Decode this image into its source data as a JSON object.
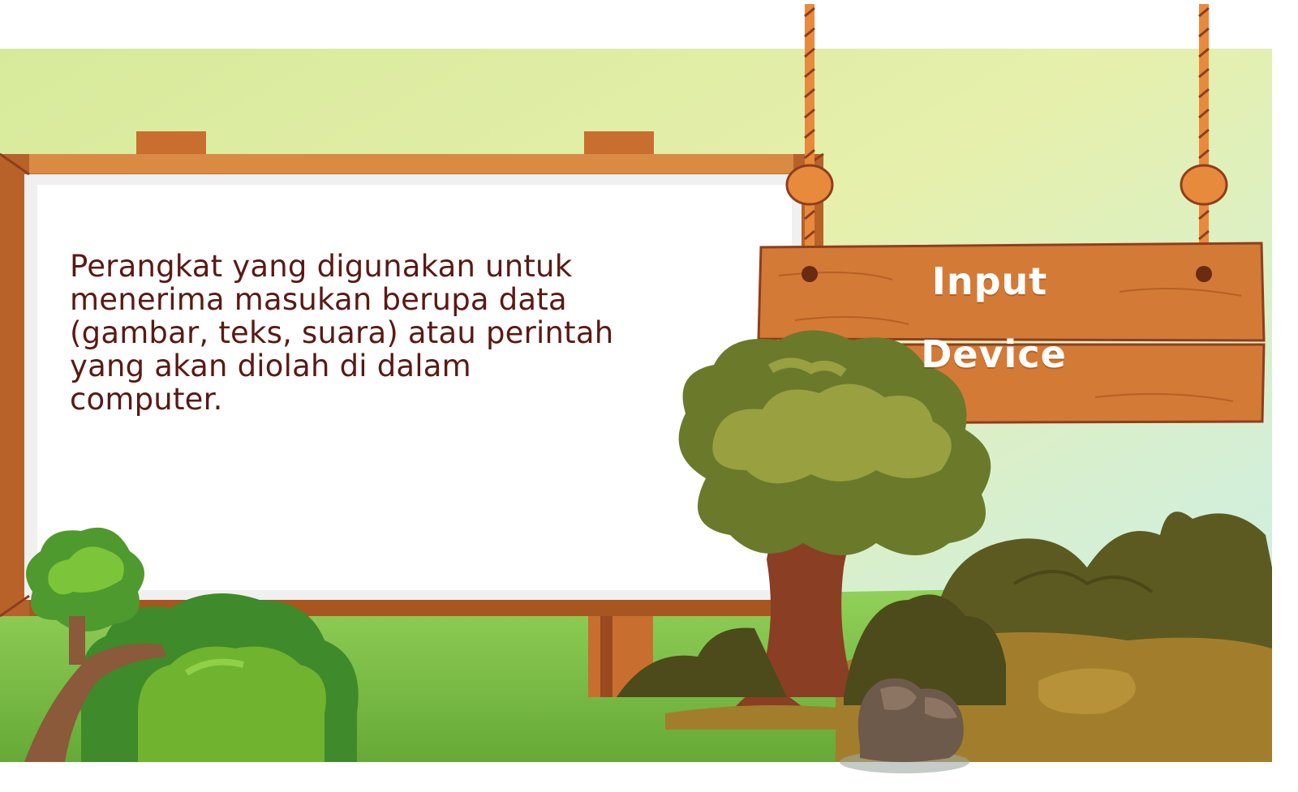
{
  "board": {
    "description": "Perangkat yang digunakan untuk\nmenerima masukan berupa data\n(gambar, teks, suara) atau perintah\nyang akan diolah di dalam\ncomputer."
  },
  "sign": {
    "line1": "Input",
    "line2": "Device"
  },
  "colors": {
    "wood": "#d47a37",
    "wood_dark": "#8e3e1c",
    "text": "#5a1a14",
    "grass": "#7dbe46",
    "rope": "#e88a3c"
  }
}
